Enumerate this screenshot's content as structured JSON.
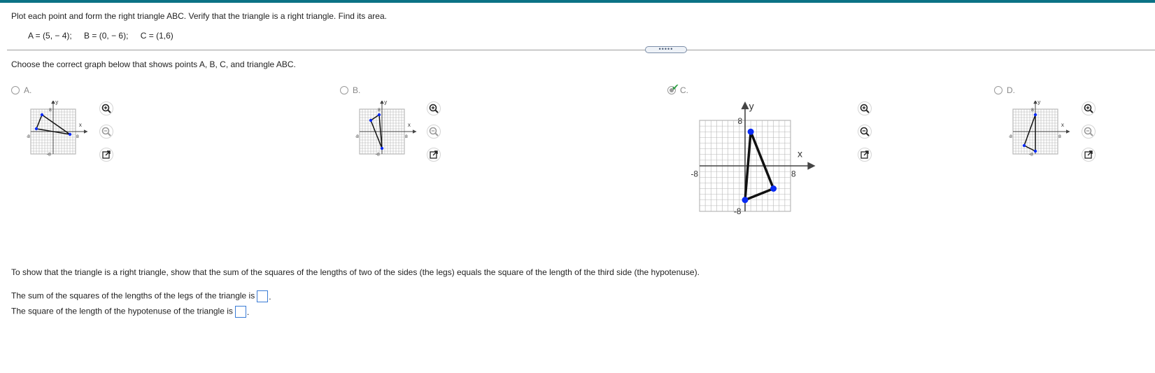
{
  "problem": {
    "prompt": "Plot each point and form the right triangle ABC. Verify that the triangle is a right triangle. Find its area.",
    "points": [
      "A = (5, − 4);",
      "B = (0, − 6);",
      "C = (1,6)"
    ],
    "divider_handle": "•••••",
    "choose_text": "Choose the correct graph below that shows points A, B, C, and triangle ABC."
  },
  "choices": [
    {
      "label": "A.",
      "selected": false,
      "correct": false
    },
    {
      "label": "B.",
      "selected": false,
      "correct": false
    },
    {
      "label": "C.",
      "selected": true,
      "correct": true
    },
    {
      "label": "D.",
      "selected": false,
      "correct": false
    }
  ],
  "graphs": [
    {
      "name": "A",
      "xlabel": "x",
      "ylabel": "y",
      "tick_left": "-8",
      "tick_right": "8",
      "tick_top": "8",
      "tick_bottom": "-8"
    },
    {
      "name": "B",
      "xlabel": "x",
      "ylabel": "y",
      "tick_left": "-8",
      "tick_right": "8",
      "tick_top": "8",
      "tick_bottom": "-8"
    },
    {
      "name": "C",
      "xlabel": "x",
      "ylabel": "y",
      "tick_left": "-8",
      "tick_right": "8",
      "tick_top": "8",
      "tick_bottom": "-8"
    },
    {
      "name": "D",
      "xlabel": "x",
      "ylabel": "y",
      "tick_left": "-8",
      "tick_right": "8",
      "tick_top": "8",
      "tick_bottom": "-8"
    }
  ],
  "chart_data": [
    {
      "type": "scatter",
      "name": "A",
      "xlim": [
        -8,
        8
      ],
      "ylim": [
        -8,
        8
      ],
      "grid": true,
      "points": [
        [
          -6,
          1
        ],
        [
          -4,
          6
        ],
        [
          6,
          -1
        ]
      ]
    },
    {
      "type": "scatter",
      "name": "B",
      "xlim": [
        -8,
        8
      ],
      "ylim": [
        -8,
        8
      ],
      "grid": true,
      "points": [
        [
          -1,
          6
        ],
        [
          0,
          -6
        ],
        [
          -4,
          4
        ]
      ]
    },
    {
      "type": "scatter",
      "name": "C",
      "xlim": [
        -8,
        8
      ],
      "ylim": [
        -8,
        8
      ],
      "grid": true,
      "points": [
        [
          5,
          -4
        ],
        [
          0,
          -6
        ],
        [
          1,
          6
        ]
      ]
    },
    {
      "type": "scatter",
      "name": "D",
      "xlim": [
        -8,
        8
      ],
      "ylim": [
        -8,
        8
      ],
      "grid": true,
      "points": [
        [
          -4,
          -5
        ],
        [
          0,
          6
        ],
        [
          0,
          -7
        ]
      ]
    }
  ],
  "explanation": "To show that the triangle is a right triangle, show that the sum of the squares of the lengths of two of the sides (the legs) equals the square of the length of the third side (the hypotenuse).",
  "answers": {
    "legs_text": "The sum of the squares of the lengths of the legs of the triangle is",
    "legs_value": "",
    "hyp_text": "The square of the length of the hypotenuse of the triangle is",
    "hyp_value": "",
    "period": "."
  }
}
